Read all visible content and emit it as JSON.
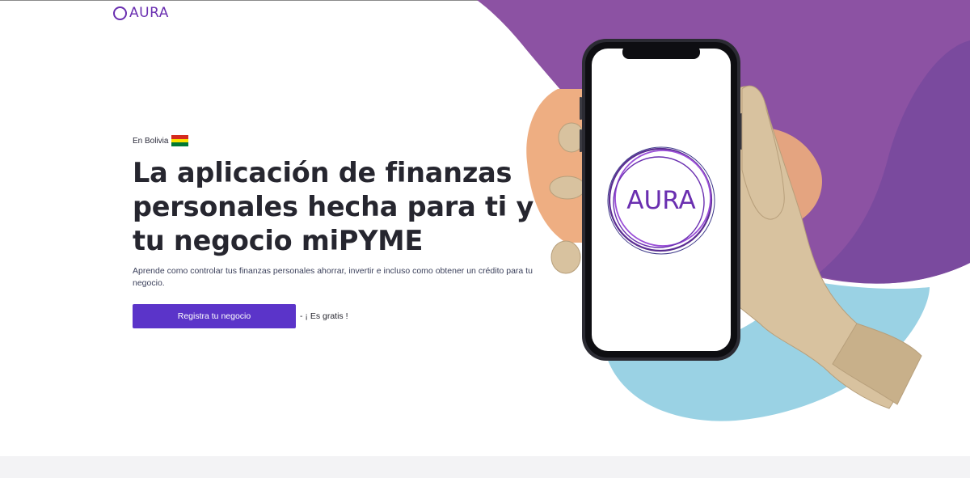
{
  "header": {
    "logo_text": "AURA"
  },
  "hero": {
    "country_label": "En Bolivia",
    "flag_icon": "bolivia-flag-icon",
    "headline": "La aplicación de finanzas personales hecha para ti y tu negocio miPYME",
    "subtitle": "Aprende como controlar tus finanzas personales ahorrar, invertir e incluso como obtener un crédito para tu negocio.",
    "cta_label": "Registra tu negocio",
    "cta_note": "- ¡ Es gratis !",
    "phone_logo_text": "AURA"
  },
  "colors": {
    "brand_purple": "#6a2fb0",
    "button": "#5b34c9",
    "blob_purple": "#8c52a3",
    "blob_peach": "#eeae82",
    "blob_blue": "#9ad2e4"
  }
}
